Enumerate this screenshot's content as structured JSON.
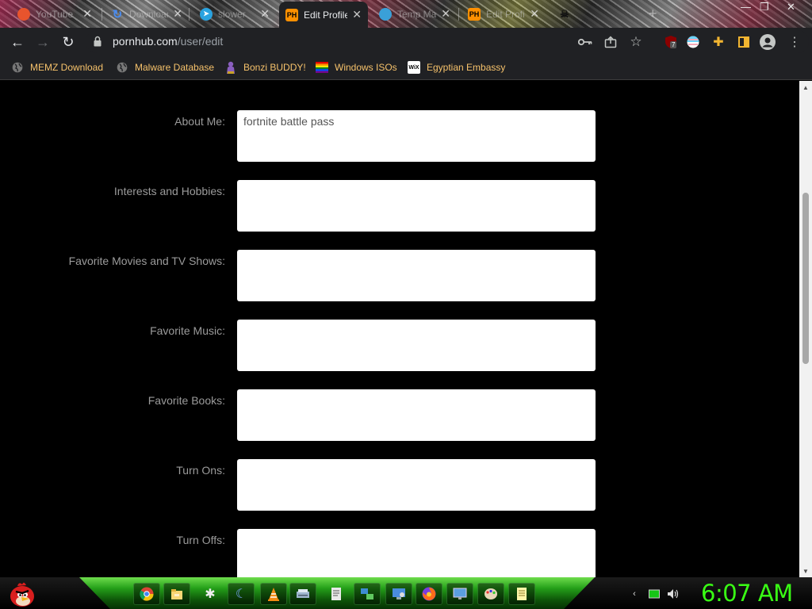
{
  "browser": {
    "tabs": [
      {
        "title": "YouTube",
        "favicon": "brave-icon",
        "color": "#e8542d"
      },
      {
        "title": "Download",
        "favicon": "refresh-icon",
        "color": "#4a8cf0"
      },
      {
        "title": "slower",
        "favicon": "telegram-icon",
        "color": "#2aa3e0"
      },
      {
        "title": "Edit Profile",
        "favicon": "ph-logo-icon",
        "color": "#ff9000",
        "active": true
      },
      {
        "title": "Temp Mail",
        "favicon": "mail-icon",
        "color": "#3aa0d8"
      },
      {
        "title": "Edit Profile",
        "favicon": "ph-logo-icon",
        "color": "#ff9000"
      },
      {
        "title": "",
        "favicon": "skull-icon",
        "color": "#333"
      }
    ],
    "favicon_text": "PH",
    "address": {
      "host": "pornhub.com",
      "path": "/user/edit"
    },
    "extension_badge": "7",
    "bookmarks": [
      {
        "label": "MEMZ Download",
        "icon": "globe-icon"
      },
      {
        "label": "Malware Database",
        "icon": "globe-icon"
      },
      {
        "label": "Bonzi BUDDY!",
        "icon": "gorilla-icon"
      },
      {
        "label": "Windows ISOs",
        "icon": "windows-flag-icon"
      },
      {
        "label": "Egyptian Embassy",
        "icon": "wix-icon",
        "icon_text": "WiX"
      }
    ]
  },
  "profile_form": {
    "fields": [
      {
        "label": "About Me:",
        "value": "fortnite battle pass"
      },
      {
        "label": "Interests and Hobbies:",
        "value": ""
      },
      {
        "label": "Favorite Movies and TV Shows:",
        "value": ""
      },
      {
        "label": "Favorite Music:",
        "value": ""
      },
      {
        "label": "Favorite Books:",
        "value": ""
      },
      {
        "label": "Turn Ons:",
        "value": ""
      },
      {
        "label": "Turn Offs:",
        "value": ""
      }
    ]
  },
  "scrollbar": {
    "position_fraction": 0.33
  },
  "taskbar": {
    "pinned": [
      "chrome-icon",
      "file-explorer-icon",
      "spider-app-icon",
      "moon-app-icon",
      "vlc-icon",
      "scanner-icon",
      "notepad-icon",
      "network-icon",
      "remote-desktop-icon",
      "firefox-icon",
      "display-icon",
      "paint-icon",
      "notes-icon"
    ],
    "tray": [
      "chevron-icon",
      "battery-icon",
      "volume-icon"
    ],
    "clock": "6:07 AM"
  }
}
